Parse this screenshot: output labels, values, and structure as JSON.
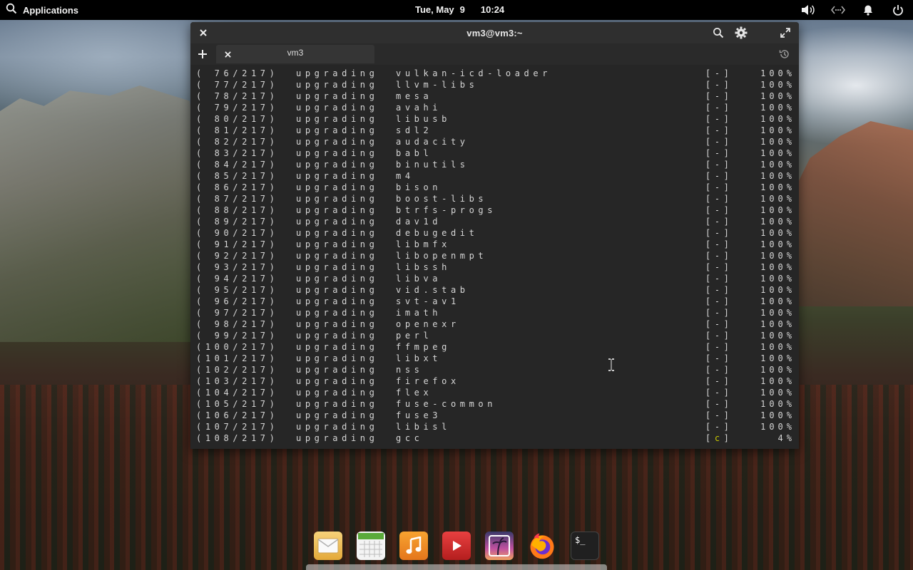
{
  "panel": {
    "apps_label": "Applications",
    "date_day": "Tue, May",
    "date_num": "9",
    "time": "10:24"
  },
  "window": {
    "title": "vm3@vm3:~",
    "tab_label": "vm3"
  },
  "terminal": {
    "lines": [
      {
        "idx": "( 76/217)",
        "action": "upgrading",
        "pkg": "vulkan-icd-loader",
        "bar": "[-]",
        "pct": "100%"
      },
      {
        "idx": "( 77/217)",
        "action": "upgrading",
        "pkg": "llvm-libs",
        "bar": "[-]",
        "pct": "100%"
      },
      {
        "idx": "( 78/217)",
        "action": "upgrading",
        "pkg": "mesa",
        "bar": "[-]",
        "pct": "100%"
      },
      {
        "idx": "( 79/217)",
        "action": "upgrading",
        "pkg": "avahi",
        "bar": "[-]",
        "pct": "100%"
      },
      {
        "idx": "( 80/217)",
        "action": "upgrading",
        "pkg": "libusb",
        "bar": "[-]",
        "pct": "100%"
      },
      {
        "idx": "( 81/217)",
        "action": "upgrading",
        "pkg": "sdl2",
        "bar": "[-]",
        "pct": "100%"
      },
      {
        "idx": "( 82/217)",
        "action": "upgrading",
        "pkg": "audacity",
        "bar": "[-]",
        "pct": "100%"
      },
      {
        "idx": "( 83/217)",
        "action": "upgrading",
        "pkg": "babl",
        "bar": "[-]",
        "pct": "100%"
      },
      {
        "idx": "( 84/217)",
        "action": "upgrading",
        "pkg": "binutils",
        "bar": "[-]",
        "pct": "100%"
      },
      {
        "idx": "( 85/217)",
        "action": "upgrading",
        "pkg": "m4",
        "bar": "[-]",
        "pct": "100%"
      },
      {
        "idx": "( 86/217)",
        "action": "upgrading",
        "pkg": "bison",
        "bar": "[-]",
        "pct": "100%"
      },
      {
        "idx": "( 87/217)",
        "action": "upgrading",
        "pkg": "boost-libs",
        "bar": "[-]",
        "pct": "100%"
      },
      {
        "idx": "( 88/217)",
        "action": "upgrading",
        "pkg": "btrfs-progs",
        "bar": "[-]",
        "pct": "100%"
      },
      {
        "idx": "( 89/217)",
        "action": "upgrading",
        "pkg": "dav1d",
        "bar": "[-]",
        "pct": "100%"
      },
      {
        "idx": "( 90/217)",
        "action": "upgrading",
        "pkg": "debugedit",
        "bar": "[-]",
        "pct": "100%"
      },
      {
        "idx": "( 91/217)",
        "action": "upgrading",
        "pkg": "libmfx",
        "bar": "[-]",
        "pct": "100%"
      },
      {
        "idx": "( 92/217)",
        "action": "upgrading",
        "pkg": "libopenmpt",
        "bar": "[-]",
        "pct": "100%"
      },
      {
        "idx": "( 93/217)",
        "action": "upgrading",
        "pkg": "libssh",
        "bar": "[-]",
        "pct": "100%"
      },
      {
        "idx": "( 94/217)",
        "action": "upgrading",
        "pkg": "libva",
        "bar": "[-]",
        "pct": "100%"
      },
      {
        "idx": "( 95/217)",
        "action": "upgrading",
        "pkg": "vid.stab",
        "bar": "[-]",
        "pct": "100%"
      },
      {
        "idx": "( 96/217)",
        "action": "upgrading",
        "pkg": "svt-av1",
        "bar": "[-]",
        "pct": "100%"
      },
      {
        "idx": "( 97/217)",
        "action": "upgrading",
        "pkg": "imath",
        "bar": "[-]",
        "pct": "100%"
      },
      {
        "idx": "( 98/217)",
        "action": "upgrading",
        "pkg": "openexr",
        "bar": "[-]",
        "pct": "100%"
      },
      {
        "idx": "( 99/217)",
        "action": "upgrading",
        "pkg": "perl",
        "bar": "[-]",
        "pct": "100%"
      },
      {
        "idx": "(100/217)",
        "action": "upgrading",
        "pkg": "ffmpeg",
        "bar": "[-]",
        "pct": "100%"
      },
      {
        "idx": "(101/217)",
        "action": "upgrading",
        "pkg": "libxt",
        "bar": "[-]",
        "pct": "100%"
      },
      {
        "idx": "(102/217)",
        "action": "upgrading",
        "pkg": "nss",
        "bar": "[-]",
        "pct": "100%"
      },
      {
        "idx": "(103/217)",
        "action": "upgrading",
        "pkg": "firefox",
        "bar": "[-]",
        "pct": "100%"
      },
      {
        "idx": "(104/217)",
        "action": "upgrading",
        "pkg": "flex",
        "bar": "[-]",
        "pct": "100%"
      },
      {
        "idx": "(105/217)",
        "action": "upgrading",
        "pkg": "fuse-common",
        "bar": "[-]",
        "pct": "100%"
      },
      {
        "idx": "(106/217)",
        "action": "upgrading",
        "pkg": "fuse3",
        "bar": "[-]",
        "pct": "100%"
      },
      {
        "idx": "(107/217)",
        "action": "upgrading",
        "pkg": "libisl",
        "bar": "[-]",
        "pct": "100%"
      },
      {
        "idx": "(108/217)",
        "action": "upgrading",
        "pkg": "gcc",
        "bar": "[c]",
        "pct": "4%"
      }
    ]
  },
  "dock": {
    "items": [
      "mail-icon",
      "calendar-icon",
      "music-icon",
      "videos-icon",
      "photos-icon",
      "firefox-icon",
      "terminal-icon"
    ],
    "terminal_glyph": "$_"
  },
  "colors": {
    "panel_bg": "#000000",
    "terminal_bg": "#262626",
    "terminal_fg": "#d6d6d6",
    "progress_accent": "#c8c800"
  }
}
